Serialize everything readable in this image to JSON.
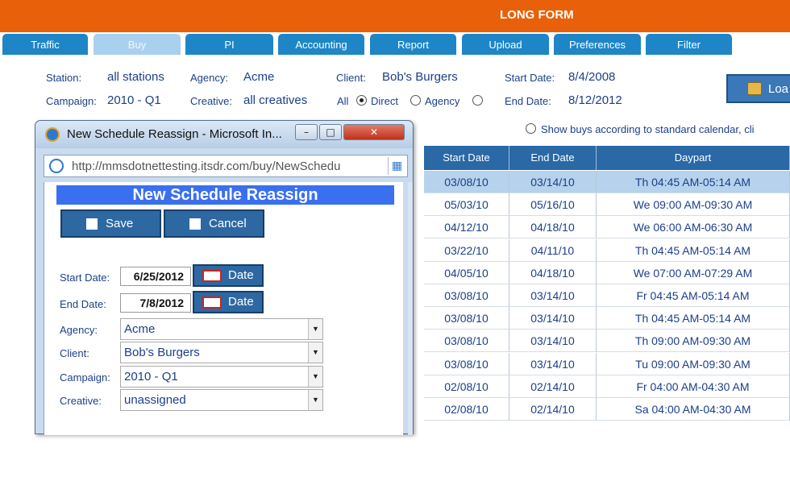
{
  "app": {
    "title": "LONG FORM"
  },
  "tabs": [
    {
      "label": "Traffic"
    },
    {
      "label": "Buy"
    },
    {
      "label": "PI"
    },
    {
      "label": "Accounting"
    },
    {
      "label": "Report"
    },
    {
      "label": "Upload"
    },
    {
      "label": "Preferences"
    },
    {
      "label": "Filter"
    }
  ],
  "active_tab": "Buy",
  "filters": {
    "station_label": "Station:",
    "station_value": "all stations",
    "agency_label": "Agency:",
    "agency_value": "Acme",
    "client_label": "Client:",
    "client_value": "Bob's Burgers",
    "start_label": "Start Date:",
    "start_value": "8/4/2008",
    "campaign_label": "Campaign:",
    "campaign_value": "2010 - Q1",
    "creative_label": "Creative:",
    "creative_value": "all creatives",
    "mode_all": "All",
    "mode_direct": "Direct",
    "mode_agency": "Agency",
    "mode_selected": "Direct",
    "end_label": "End Date:",
    "end_value": "8/12/2012",
    "calendar_option": "Show buys according to standard calendar, cli",
    "load_button": "Loa"
  },
  "grid": {
    "columns": [
      "Start Date",
      "End Date",
      "Daypart"
    ],
    "rows": [
      [
        "03/08/10",
        "03/14/10",
        "Th 04:45 AM-05:14 AM"
      ],
      [
        "05/03/10",
        "05/16/10",
        "We 09:00 AM-09:30 AM"
      ],
      [
        "04/12/10",
        "04/18/10",
        "We 06:00 AM-06:30 AM"
      ],
      [
        "03/22/10",
        "04/11/10",
        "Th 04:45 AM-05:14 AM"
      ],
      [
        "04/05/10",
        "04/18/10",
        "We 07:00 AM-07:29 AM"
      ],
      [
        "03/08/10",
        "03/14/10",
        "Fr 04:45 AM-05:14 AM"
      ],
      [
        "03/08/10",
        "03/14/10",
        "Th 04:45 AM-05:14 AM"
      ],
      [
        "03/08/10",
        "03/14/10",
        "Th 09:00 AM-09:30 AM"
      ],
      [
        "03/08/10",
        "03/14/10",
        "Tu 09:00 AM-09:30 AM"
      ],
      [
        "02/08/10",
        "02/14/10",
        "Fr 04:00 AM-04:30 AM"
      ],
      [
        "02/08/10",
        "02/14/10",
        "Sa 04:00 AM-04:30 AM"
      ]
    ]
  },
  "popup": {
    "window_title": "New Schedule Reassign - Microsoft In...",
    "url": "http://mmsdotnettesting.itsdr.com/buy/NewSchedu",
    "heading": "New Schedule Reassign",
    "save_label": "Save",
    "cancel_label": "Cancel",
    "start_label": "Start Date:",
    "start_value": "6/25/2012",
    "end_label": "End Date:",
    "end_value": "7/8/2012",
    "date_button": "Date",
    "agency_label": "Agency:",
    "agency_value": "Acme",
    "client_label": "Client:",
    "client_value": "Bob's Burgers",
    "campaign_label": "Campaign:",
    "campaign_value": "2010 - Q1",
    "creative_label": "Creative:",
    "creative_value": "unassigned"
  },
  "colors": {
    "header": "#e8600a",
    "tab": "#1e86c6",
    "tab_active": "#a9d0ef",
    "grid_header": "#2a68a6",
    "banner": "#3a6ff0"
  }
}
